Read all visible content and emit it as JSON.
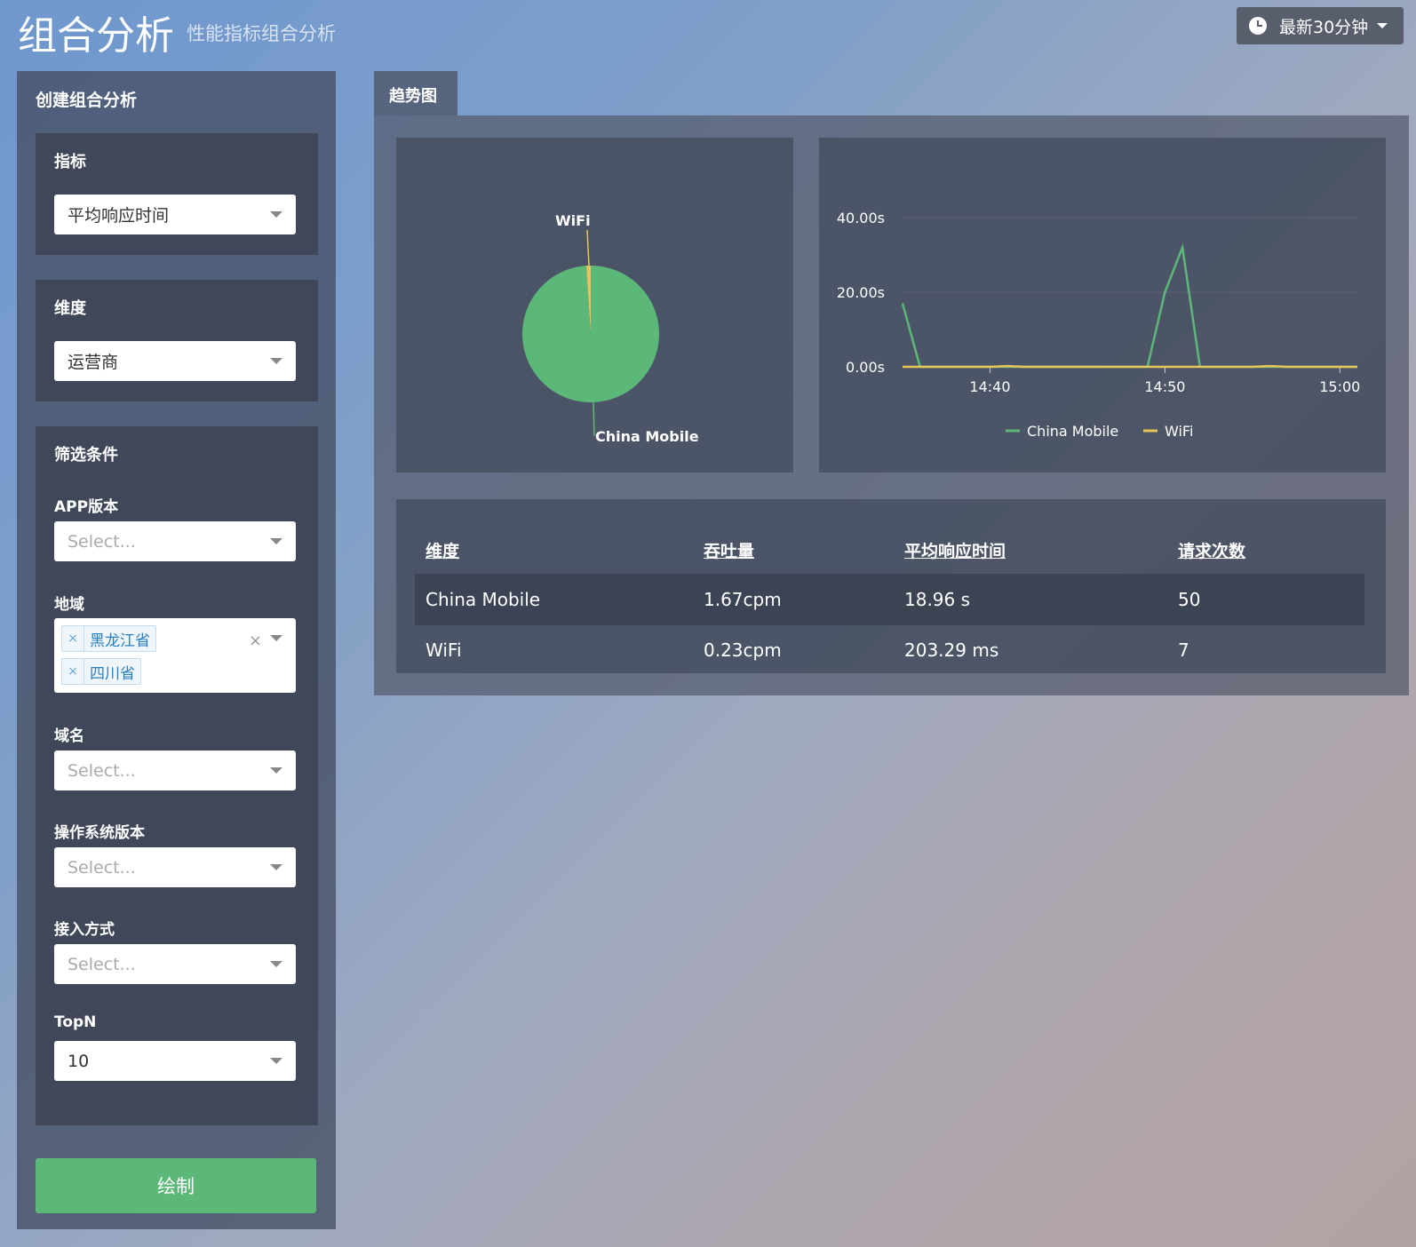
{
  "header": {
    "title": "组合分析",
    "subtitle": "性能指标组合分析",
    "time_range": "最新30分钟"
  },
  "sidebar": {
    "title": "创建组合分析",
    "metric": {
      "label": "指标",
      "value": "平均响应时间"
    },
    "dimension": {
      "label": "维度",
      "value": "运营商"
    },
    "filters": {
      "title": "筛选条件",
      "app_version": {
        "label": "APP版本",
        "placeholder": "Select..."
      },
      "region": {
        "label": "地域",
        "tags": [
          "黑龙江省",
          "四川省"
        ]
      },
      "domain": {
        "label": "域名",
        "placeholder": "Select..."
      },
      "os_version": {
        "label": "操作系统版本",
        "placeholder": "Select..."
      },
      "access": {
        "label": "接入方式",
        "placeholder": "Select..."
      },
      "topn": {
        "label": "TopN",
        "value": "10"
      }
    },
    "draw_label": "绘制"
  },
  "tab": {
    "label": "趋势图"
  },
  "colors": {
    "china_mobile": "#5cb878",
    "wifi": "#e8c55a"
  },
  "chart_data": [
    {
      "type": "pie",
      "labels": [
        "China Mobile",
        "WiFi"
      ],
      "values": [
        18.96,
        0.203
      ]
    },
    {
      "type": "line",
      "x": [
        "14:35",
        "14:36",
        "14:37",
        "14:38",
        "14:39",
        "14:40",
        "14:41",
        "14:42",
        "14:43",
        "14:44",
        "14:45",
        "14:46",
        "14:47",
        "14:48",
        "14:49",
        "14:50",
        "14:51",
        "14:52",
        "14:53",
        "14:54",
        "14:55",
        "14:56",
        "14:57",
        "14:58",
        "14:59",
        "15:00",
        "15:01"
      ],
      "xticks": [
        "14:40",
        "14:50",
        "15:00"
      ],
      "yticks": [
        "0.00s",
        "20.00s",
        "40.00s"
      ],
      "ylim": [
        0,
        40
      ],
      "series": [
        {
          "name": "China Mobile",
          "values": [
            17,
            0,
            0,
            0,
            0,
            0,
            0,
            0,
            0,
            0,
            0,
            0,
            0,
            0,
            0,
            20,
            32,
            0,
            0,
            0,
            0,
            0,
            0,
            0,
            0,
            0,
            0
          ]
        },
        {
          "name": "WiFi",
          "values": [
            0,
            0,
            0,
            0,
            0,
            0,
            0.2,
            0,
            0,
            0,
            0,
            0,
            0,
            0,
            0,
            0,
            0,
            0,
            0,
            0,
            0,
            0.2,
            0,
            0,
            0,
            0,
            0
          ]
        }
      ],
      "legend": "bottom"
    }
  ],
  "table": {
    "headers": [
      "维度",
      "吞吐量",
      "平均响应时间",
      "请求次数"
    ],
    "rows": [
      [
        "China Mobile",
        "1.67cpm",
        "18.96 s",
        "50"
      ],
      [
        "WiFi",
        "0.23cpm",
        "203.29 ms",
        "7"
      ]
    ]
  }
}
